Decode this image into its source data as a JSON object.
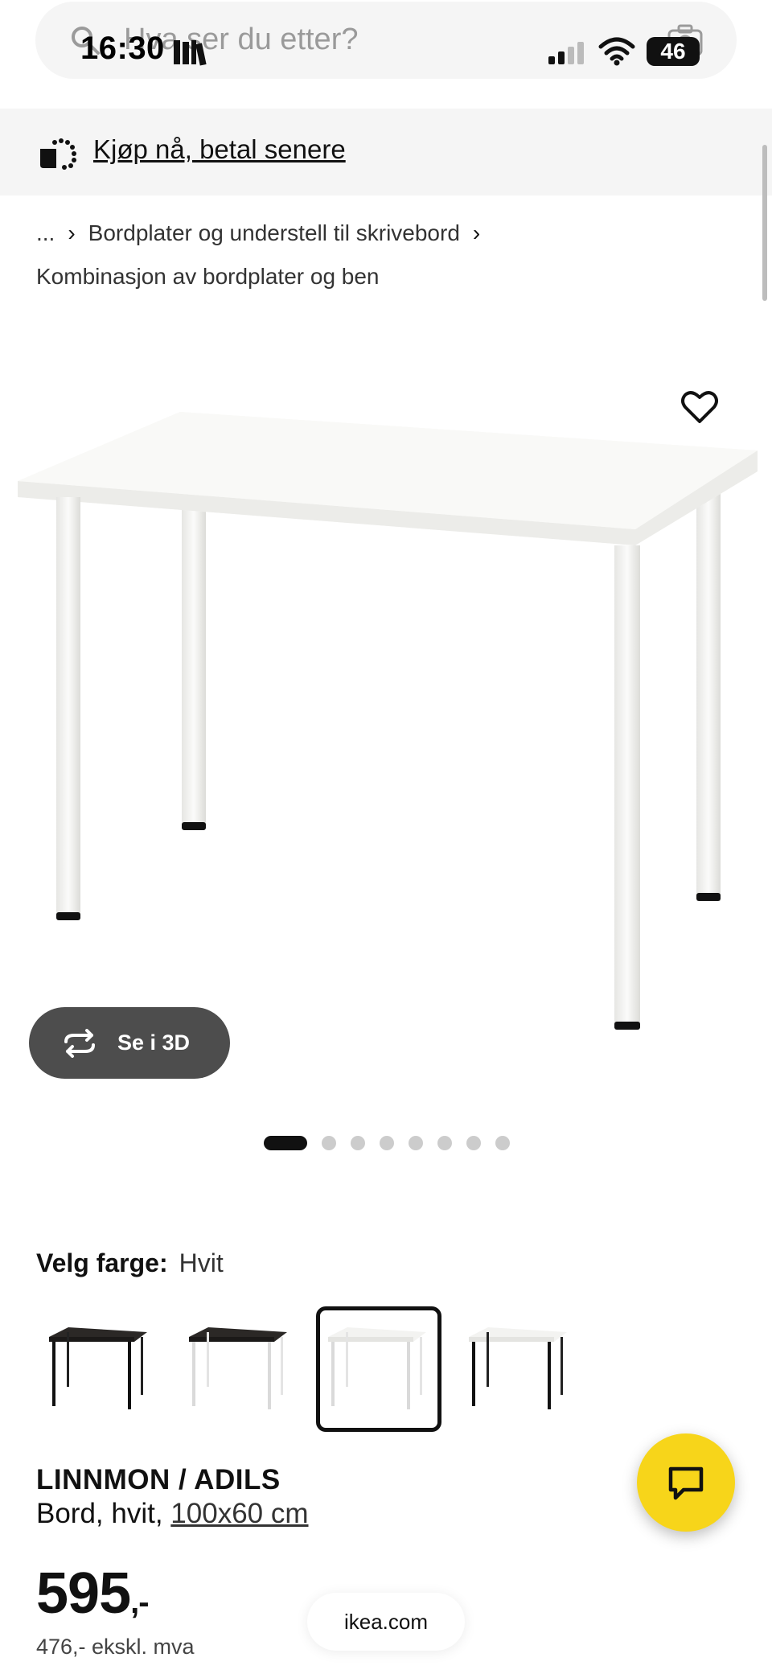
{
  "status_bar": {
    "time": "16:30",
    "battery": "46"
  },
  "search": {
    "placeholder": "Hva ser du etter?"
  },
  "banner": {
    "pay_later": "Kjøp nå, betal senere"
  },
  "breadcrumb": {
    "ellipsis": "...",
    "item1": "Bordplater og understell til skrivebord",
    "item2": "Kombinasjon av bordplater og ben"
  },
  "gallery": {
    "view_3d_label": "Se i 3D",
    "image_count": 8,
    "active_index": 0
  },
  "color": {
    "label": "Velg farge:",
    "selected": "Hvit",
    "swatches": [
      "black-brown top / black legs",
      "black-brown top / white legs",
      "white top / white legs",
      "white top / black legs"
    ],
    "selected_index": 2
  },
  "product": {
    "name": "LINNMON / ADILS",
    "description": "Bord, hvit, ",
    "dimensions": "100x60 cm",
    "price": "595",
    "price_suffix": ",-",
    "price_ex_vat": "476,- ekskl. mva"
  },
  "browser": {
    "url": "ikea.com"
  },
  "colors": {
    "chat_button": "#f7d51a",
    "dark_button": "#4d4d4d"
  }
}
